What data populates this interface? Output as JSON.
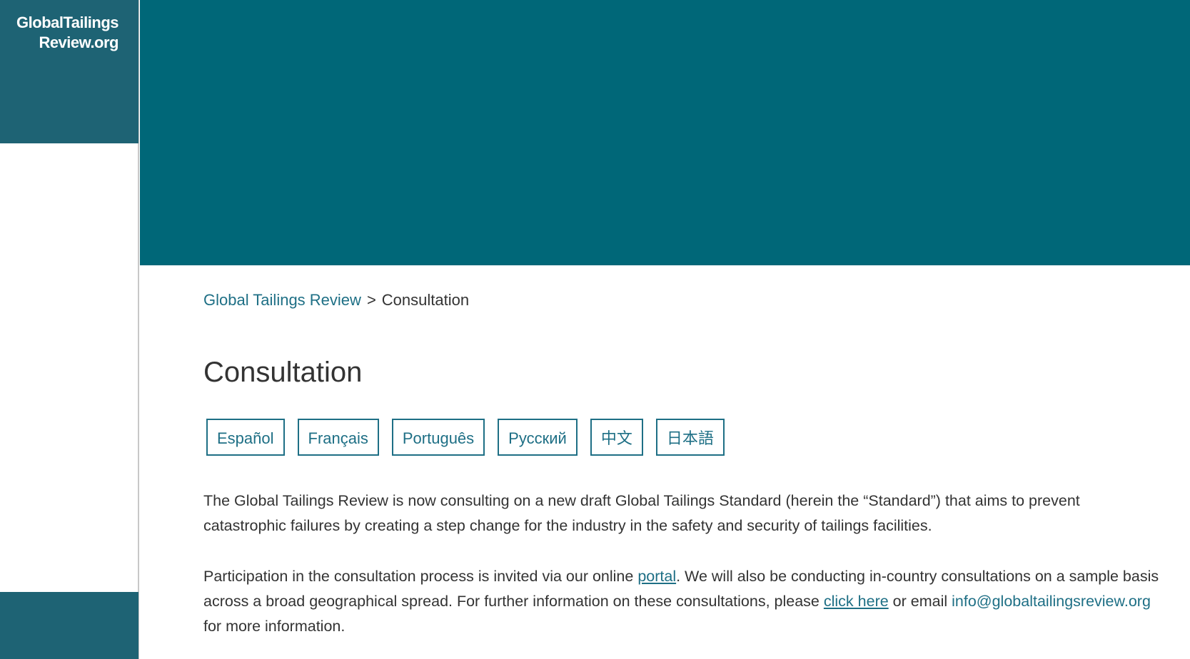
{
  "site": {
    "logo_line1": "GlobalTailings",
    "logo_line2": "Review.org"
  },
  "breadcrumb": {
    "home": "Global Tailings Review",
    "separator": ">",
    "current": "Consultation"
  },
  "page": {
    "title": "Consultation"
  },
  "languages": [
    "Español",
    "Français",
    "Português",
    "Русский",
    "中文",
    "日本語"
  ],
  "paragraph1": "The Global Tailings Review is now consulting on a new draft Global Tailings Standard (herein the “Standard”) that aims to prevent catastrophic failures by creating a step change for the industry in the safety and security of tailings facilities.",
  "paragraph2": {
    "part1": "Participation in the consultation process is invited via our online ",
    "portal_link": "portal",
    "part2": ". We will also be conducting in-country consultations on a sample basis across a broad geographical spread. For further information on these consultations, please ",
    "click_link": "click here",
    "part3": " or email ",
    "email_link": "info@globaltailingsreview.org",
    "part4": " for more information."
  },
  "colors": {
    "hero": "#006778",
    "sidebar_block": "#1e6374",
    "link": "#1e6f85",
    "text": "#333333"
  }
}
